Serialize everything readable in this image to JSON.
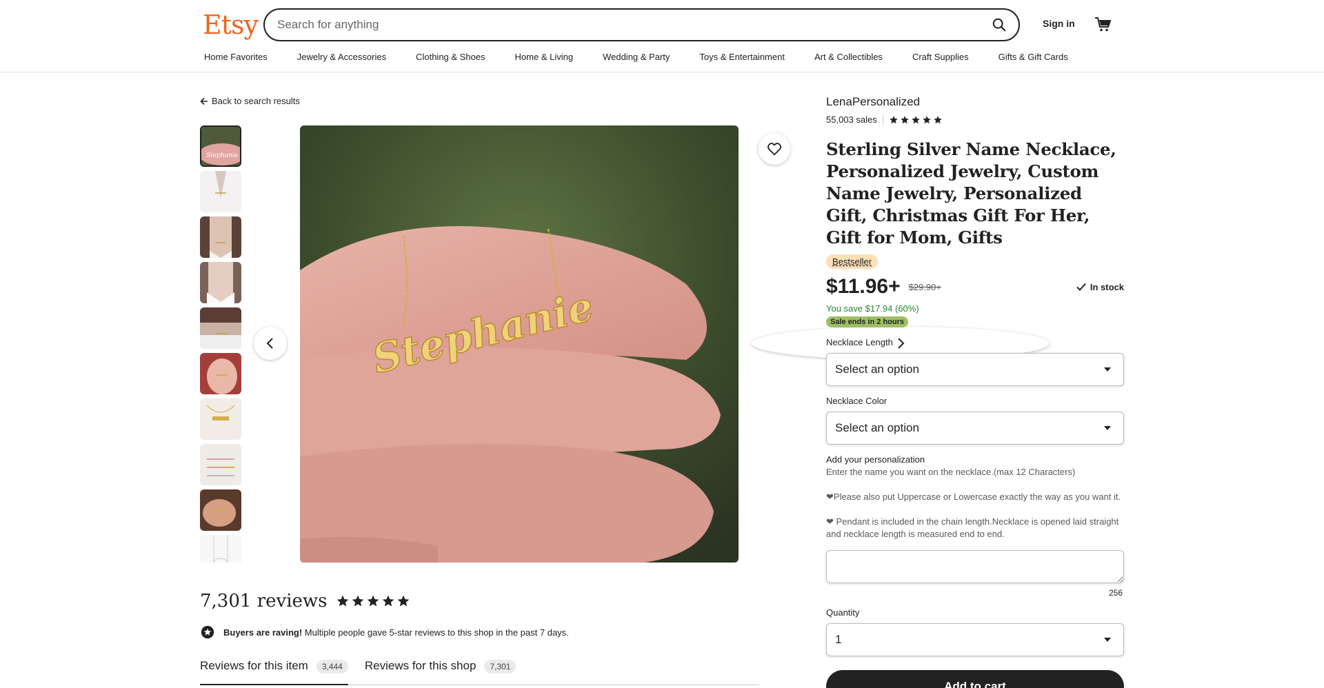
{
  "header": {
    "logo": "Etsy",
    "search_placeholder": "Search for anything",
    "signin": "Sign in",
    "nav": [
      "Home Favorites",
      "Jewelry & Accessories",
      "Clothing & Shoes",
      "Home & Living",
      "Wedding & Party",
      "Toys & Entertainment",
      "Art & Collectibles",
      "Craft Supplies",
      "Gifts & Gift Cards"
    ]
  },
  "back_link": "Back to search results",
  "gallery": {
    "thumbnail_count": 10,
    "active_index": 0,
    "main_image_text": "Stephanie"
  },
  "reviews": {
    "title": "7,301 reviews",
    "rating": 5,
    "raving_bold": "Buyers are raving!",
    "raving_text": "Multiple people gave 5-star reviews to this shop in the past 7 days.",
    "tabs": [
      {
        "label": "Reviews for this item",
        "count": "3,444"
      },
      {
        "label": "Reviews for this shop",
        "count": "7,301"
      }
    ]
  },
  "product": {
    "shop_name": "LenaPersonalized",
    "sales": "55,003 sales",
    "rating": 5,
    "title": "Sterling Silver Name Necklace, Personalized Jewelry, Custom Name Jewelry, Personalized Gift, Christmas Gift For Her, Gift for Mom, Gifts",
    "badge": "Bestseller",
    "price": "$11.96+",
    "old_price": "$29.90+",
    "stock": "In stock",
    "you_save": "You save $17.94 (60%)",
    "sale_ends": "Sale ends in 2 hours",
    "length_label": "Necklace Length",
    "length_value": "Select an option",
    "color_label": "Necklace Color",
    "color_value": "Select an option",
    "personalization_label": "Add your personalization",
    "personalization_lines": [
      "Enter the name you want on the necklace.(max 12 Characters)",
      "❤Please also put Uppercase or Lowercase exactly the way as you want it.",
      "❤ Pendant is included in the chain length.Necklace is opened laid straight and necklace length is measured end to end."
    ],
    "char_count": "256",
    "quantity_label": "Quantity",
    "quantity_value": "1",
    "add_to_cart": "Add to cart"
  },
  "colors": {
    "brand": "#f1641e",
    "save_green": "#258635",
    "sale_badge": "#9ec063",
    "bestseller": "#fddfb6"
  }
}
